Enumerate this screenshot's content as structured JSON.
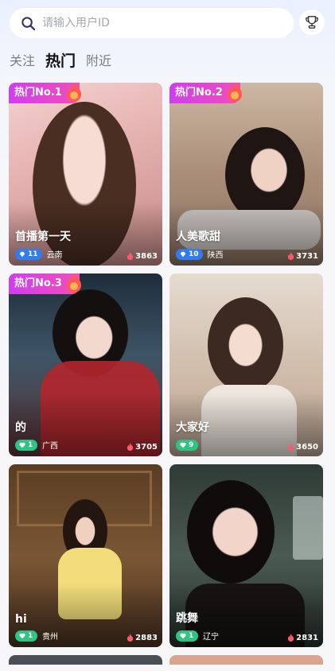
{
  "search": {
    "placeholder": "请输入用户ID"
  },
  "tabs": [
    {
      "label": "关注",
      "active": false
    },
    {
      "label": "热门",
      "active": true
    },
    {
      "label": "附近",
      "active": false
    }
  ],
  "cards": [
    {
      "name": "首播第一天",
      "rank": "热门No.1",
      "level": "11",
      "level_color": "#2f7cf6",
      "region": "云南",
      "heat": "3863",
      "bg": "#e7b9b9"
    },
    {
      "name": "人美歌甜",
      "rank": "热门No.2",
      "level": "10",
      "level_color": "#2f7cf6",
      "region": "陕西",
      "heat": "3731",
      "bg": "#b9a28d"
    },
    {
      "name": "的",
      "rank": "热门No.3",
      "level": "1",
      "level_color": "#2ec486",
      "region": "广西",
      "heat": "3705",
      "bg": "#3b5062"
    },
    {
      "name": "大家好",
      "rank": "",
      "level": "9",
      "level_color": "#2ec486",
      "region": "",
      "heat": "3650",
      "bg": "#d7c7b8"
    },
    {
      "name": "hi",
      "rank": "",
      "level": "1",
      "level_color": "#2ec486",
      "region": "贵州",
      "heat": "2883",
      "bg": "#6a4a2c"
    },
    {
      "name": "跳舞",
      "rank": "",
      "level": "1",
      "level_color": "#2ec486",
      "region": "辽宁",
      "heat": "2831",
      "bg": "#3c4a44"
    }
  ],
  "icons": {
    "search": "search-icon",
    "trophy": "trophy-icon",
    "fire": "fire-icon",
    "diamond": "diamond-icon",
    "heart": "heart-icon"
  }
}
